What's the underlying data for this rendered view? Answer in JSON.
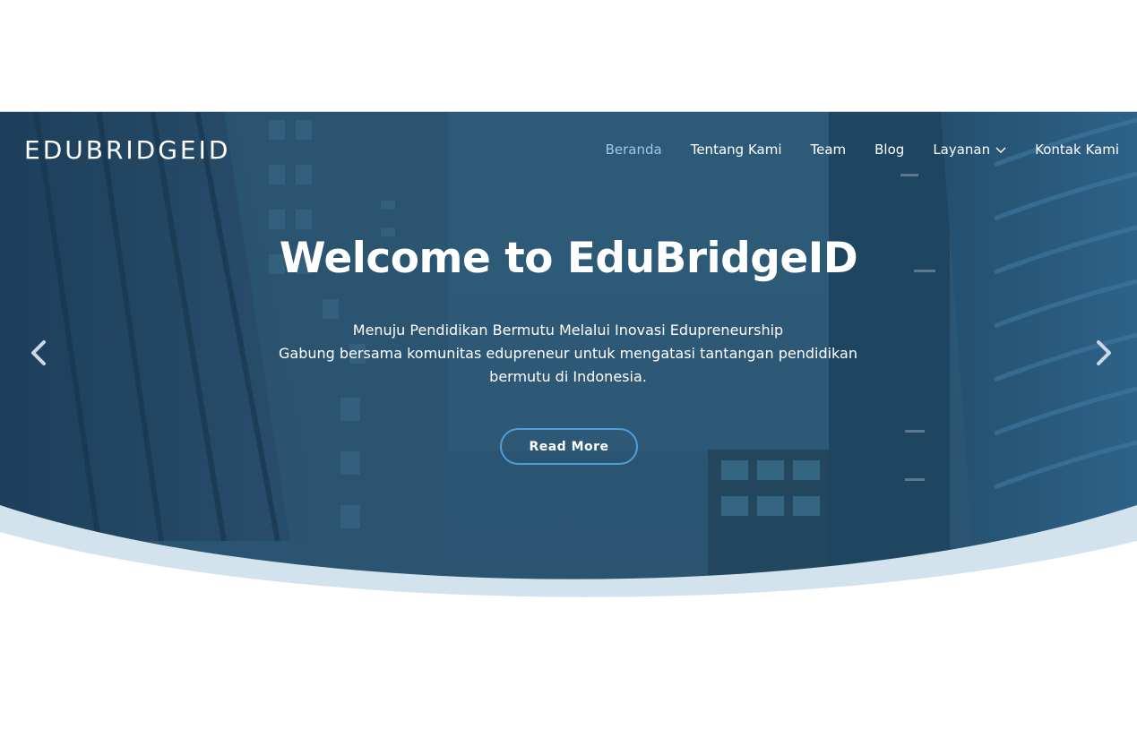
{
  "brand": {
    "logo_text": "EDUBRIDGEID"
  },
  "nav": {
    "items": [
      {
        "label": "Beranda",
        "active": true
      },
      {
        "label": "Tentang Kami",
        "active": false
      },
      {
        "label": "Team",
        "active": false
      },
      {
        "label": "Blog",
        "active": false
      },
      {
        "label": "Layanan",
        "active": false,
        "has_dropdown": true
      },
      {
        "label": "Kontak Kami",
        "active": false
      }
    ]
  },
  "hero": {
    "title": "Welcome to EduBridgeID",
    "subtitle_line1": "Menuju Pendidikan Bermutu Melalui Inovasi Edupreneurship",
    "subtitle_line2": "Gabung bersama komunitas edupreneur untuk mengatasi tantangan pendidikan bermutu di Indonesia.",
    "cta_label": "Read More",
    "prev_icon": "chevron-left-icon",
    "next_icon": "chevron-right-icon"
  },
  "colors": {
    "overlay": "#1f4f6e",
    "active_nav": "#9ec9e8",
    "button_border": "#4f9fd4",
    "wave": "#d3e3ee"
  }
}
